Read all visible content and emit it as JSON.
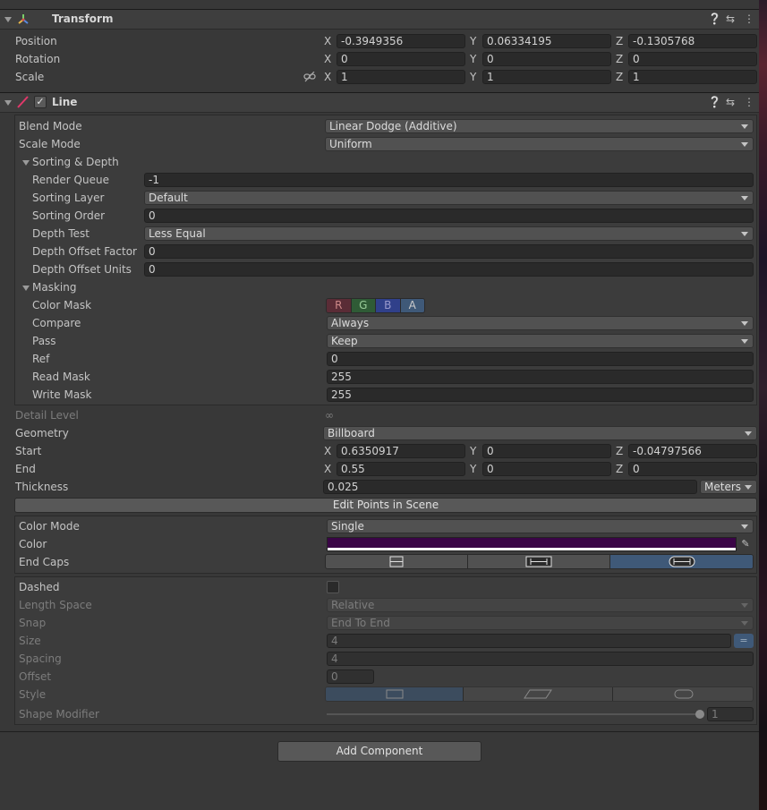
{
  "transform": {
    "title": "Transform",
    "position_label": "Position",
    "rotation_label": "Rotation",
    "scale_label": "Scale",
    "position": {
      "x": "-0.3949356",
      "y": "0.06334195",
      "z": "-0.1305768"
    },
    "rotation": {
      "x": "0",
      "y": "0",
      "z": "0"
    },
    "scale": {
      "x": "1",
      "y": "1",
      "z": "1"
    }
  },
  "axes": {
    "x": "X",
    "y": "Y",
    "z": "Z"
  },
  "line": {
    "title": "Line",
    "blend_mode_label": "Blend Mode",
    "blend_mode": "Linear Dodge (Additive)",
    "scale_mode_label": "Scale Mode",
    "scale_mode": "Uniform",
    "sorting_depth_label": "Sorting & Depth",
    "render_queue_label": "Render Queue",
    "render_queue": "-1",
    "sorting_layer_label": "Sorting Layer",
    "sorting_layer": "Default",
    "sorting_order_label": "Sorting Order",
    "sorting_order": "0",
    "depth_test_label": "Depth Test",
    "depth_test": "Less Equal",
    "depth_offset_factor_label": "Depth Offset Factor",
    "depth_offset_factor": "0",
    "depth_offset_units_label": "Depth Offset Units",
    "depth_offset_units": "0",
    "masking_label": "Masking",
    "color_mask_label": "Color Mask",
    "color_mask": [
      "R",
      "G",
      "B",
      "A"
    ],
    "compare_label": "Compare",
    "compare": "Always",
    "pass_label": "Pass",
    "pass": "Keep",
    "ref_label": "Ref",
    "ref": "0",
    "read_mask_label": "Read Mask",
    "read_mask": "255",
    "write_mask_label": "Write Mask",
    "write_mask": "255",
    "detail_level_label": "Detail Level",
    "detail_level": "∞",
    "geometry_label": "Geometry",
    "geometry": "Billboard",
    "start_label": "Start",
    "start": {
      "x": "0.6350917",
      "y": "0",
      "z": "-0.04797566"
    },
    "end_label": "End",
    "end": {
      "x": "0.55",
      "y": "0",
      "z": "0"
    },
    "thickness_label": "Thickness",
    "thickness": "0.025",
    "thickness_unit": "Meters",
    "edit_points_label": "Edit Points in Scene",
    "color_mode_label": "Color Mode",
    "color_mode": "Single",
    "color_label": "Color",
    "color_value": "#3a0546",
    "end_caps_label": "End Caps",
    "dashed_label": "Dashed",
    "length_space_label": "Length Space",
    "length_space": "Relative",
    "snap_label": "Snap",
    "snap": "End To End",
    "size_label": "Size",
    "size": "4",
    "spacing_label": "Spacing",
    "spacing": "4",
    "offset_label": "Offset",
    "offset": "0",
    "style_label": "Style",
    "shape_modifier_label": "Shape Modifier",
    "shape_modifier": "1",
    "shape_modifier_level": 1.0
  },
  "add_component_label": "Add Component",
  "colors": {
    "accent": "#3f5978",
    "mask_r": "#5a2c36",
    "mask_g": "#2f5b36",
    "mask_b": "#30408a",
    "mask_a": "#3f5978"
  }
}
